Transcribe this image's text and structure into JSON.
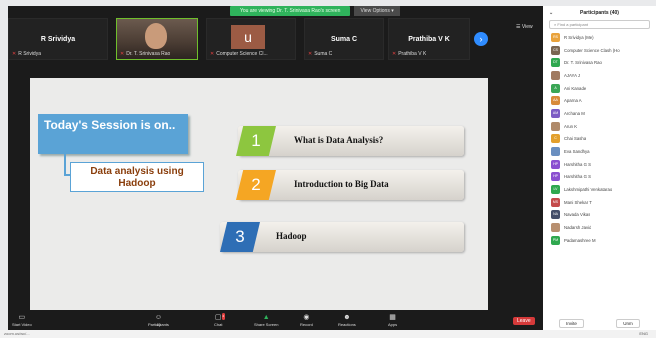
{
  "share_banner": "You are viewing Dr. T. Srinivasa Rao's screen",
  "view_options": "View Options ▾",
  "participants_strip": [
    {
      "name": "R Srividya",
      "label": "R Srividya"
    },
    {
      "name": "",
      "label": "Dr. T. Srinivasa Rao"
    },
    {
      "name": "",
      "label": "Computer Science Cl..."
    },
    {
      "name": "Suma C",
      "label": "Suma C"
    },
    {
      "name": "Prathiba V K",
      "label": "Prathiba V K"
    }
  ],
  "avatar_letter": "u",
  "view_label": "View",
  "slide": {
    "session_title": "Today's Session is on..",
    "topic": "Data analysis using Hadoop",
    "items": [
      {
        "num": "1",
        "text": "What is Data Analysis?"
      },
      {
        "num": "2",
        "text": "Introduction to Big Data"
      },
      {
        "num": "3",
        "text": "Hadoop"
      }
    ]
  },
  "toolbar": {
    "start_video": "Start Video",
    "participants": "Participants",
    "participants_count": "40",
    "chat": "Chat",
    "chat_badge": "2",
    "share_screen": "Share Screen",
    "record": "Record",
    "reactions": "Reactions",
    "apps": "Apps",
    "leave": "Leave"
  },
  "panel": {
    "title": "Participants (40)",
    "search_placeholder": "Find a participant",
    "invite": "Invite",
    "mute_all": "Unm",
    "people": [
      {
        "initials": "RS",
        "color": "#e9a23b",
        "name": "R Srividya (Me)"
      },
      {
        "initials": "CS",
        "color": "#7a6652",
        "name": "Computer Science Clash (Ho"
      },
      {
        "initials": "DT",
        "color": "#2fa84f",
        "name": "Dr. T. Srinivasa Rao"
      },
      {
        "initials": "",
        "color": "#a07a60",
        "name": "AJAYA J"
      },
      {
        "initials": "A",
        "color": "#3aa655",
        "name": "Ani Kanade"
      },
      {
        "initials": "AA",
        "color": "#d88b3a",
        "name": "Aparna A"
      },
      {
        "initials": "AM",
        "color": "#7c5cc4",
        "name": "Archana M"
      },
      {
        "initials": "",
        "color": "#b08a6a",
        "name": "Arun K"
      },
      {
        "initials": "C",
        "color": "#e3a02d",
        "name": "Chai Sasha"
      },
      {
        "initials": "",
        "color": "#6a8fc0",
        "name": "Eva Sandhya"
      },
      {
        "initials": "HP",
        "color": "#8a4fd0",
        "name": "Harshitha G S"
      },
      {
        "initials": "HP",
        "color": "#8a4fd0",
        "name": "Harshitha G S"
      },
      {
        "initials": "LV",
        "color": "#2fa84f",
        "name": "Lakshmipathi Venkatarao"
      },
      {
        "initials": "MS",
        "color": "#c44a4a",
        "name": "Mani Shekar T"
      },
      {
        "initials": "NA",
        "color": "#444e6a",
        "name": "Navada Vikas"
      },
      {
        "initials": "",
        "color": "#b89070",
        "name": "Nadarsh Javid"
      },
      {
        "initials": "PM",
        "color": "#2fa84f",
        "name": "Padamashree M"
      }
    ]
  },
  "taskbar": {
    "url": "zoom.us/wc/...",
    "tray": "ENG"
  }
}
